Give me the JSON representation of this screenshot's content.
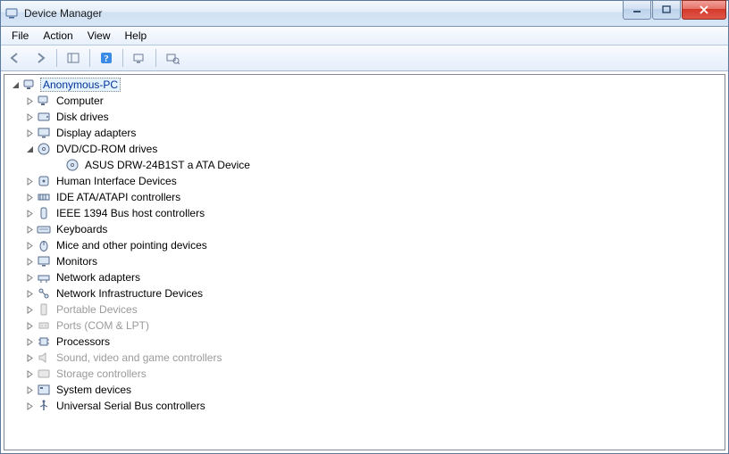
{
  "title": "Device Manager",
  "menus": [
    "File",
    "Action",
    "View",
    "Help"
  ],
  "root": "Anonymous-PC",
  "nodes": [
    {
      "label": "Computer",
      "icon": "computer",
      "state": "collapsed",
      "hidden": false
    },
    {
      "label": "Disk drives",
      "icon": "disk",
      "state": "collapsed",
      "hidden": false
    },
    {
      "label": "Display adapters",
      "icon": "display",
      "state": "collapsed",
      "hidden": false
    },
    {
      "label": "DVD/CD-ROM drives",
      "icon": "cd",
      "state": "expanded",
      "hidden": false,
      "children": [
        {
          "label": "ASUS DRW-24B1ST   a ATA Device",
          "icon": "cd",
          "hidden": false
        }
      ]
    },
    {
      "label": "Human Interface Devices",
      "icon": "hid",
      "state": "collapsed",
      "hidden": false
    },
    {
      "label": "IDE ATA/ATAPI controllers",
      "icon": "ide",
      "state": "collapsed",
      "hidden": false
    },
    {
      "label": "IEEE 1394 Bus host controllers",
      "icon": "1394",
      "state": "collapsed",
      "hidden": false
    },
    {
      "label": "Keyboards",
      "icon": "keyboard",
      "state": "collapsed",
      "hidden": false
    },
    {
      "label": "Mice and other pointing devices",
      "icon": "mouse",
      "state": "collapsed",
      "hidden": false
    },
    {
      "label": "Monitors",
      "icon": "monitor",
      "state": "collapsed",
      "hidden": false
    },
    {
      "label": "Network adapters",
      "icon": "net",
      "state": "collapsed",
      "hidden": false
    },
    {
      "label": "Network Infrastructure Devices",
      "icon": "netinfra",
      "state": "collapsed",
      "hidden": false
    },
    {
      "label": "Portable Devices",
      "icon": "portable",
      "state": "collapsed",
      "hidden": true
    },
    {
      "label": "Ports (COM & LPT)",
      "icon": "ports",
      "state": "collapsed",
      "hidden": true
    },
    {
      "label": "Processors",
      "icon": "cpu",
      "state": "collapsed",
      "hidden": false
    },
    {
      "label": "Sound, video and game controllers",
      "icon": "sound",
      "state": "collapsed",
      "hidden": true
    },
    {
      "label": "Storage controllers",
      "icon": "storage",
      "state": "collapsed",
      "hidden": true
    },
    {
      "label": "System devices",
      "icon": "system",
      "state": "collapsed",
      "hidden": false
    },
    {
      "label": "Universal Serial Bus controllers",
      "icon": "usb",
      "state": "collapsed",
      "hidden": false
    }
  ]
}
